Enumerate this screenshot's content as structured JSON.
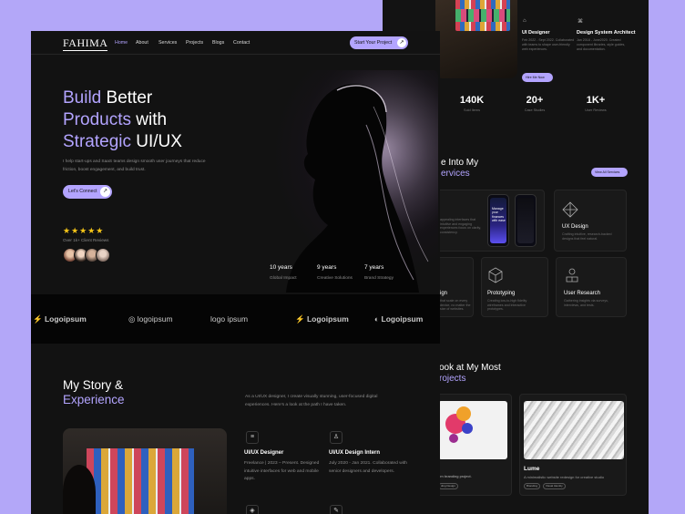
{
  "back": {
    "roles": [
      {
        "icon": "⌂",
        "title": "UI Designer",
        "desc": "Feb 2022 - Sept 2022. Collaborated with teams to shape user-friendly web experiences."
      },
      {
        "icon": "⌘",
        "title": "Design System Architect",
        "desc": "Jan 2018 - June2020. Created component libraries, style guides, and documentation."
      }
    ],
    "hire_button": "Hire Me Now",
    "stats": [
      {
        "value": "140K",
        "label": "Sold Items"
      },
      {
        "value": "20+",
        "label": "Case Studies"
      },
      {
        "value": "1K+",
        "label": "User Reviews"
      }
    ],
    "services_title_a": "e Into My",
    "services_title_b": "ervices",
    "view_services": "View All Services",
    "service_app_desc": "appealing interfaces that intuitive and engaging experiences focus on clarity, consistency.",
    "phone_text": "Manage your finances with ease",
    "services": [
      {
        "title": "UX Design",
        "desc": "Crafting intuitive, research-backed designs that feel natural."
      },
      {
        "title": "ign",
        "desc": "that scale on every device, no matter the size of websites."
      },
      {
        "title": "Prototyping",
        "desc": "Creating low-to-high fidelity wireframes and interactive prototypes."
      },
      {
        "title": "User Research",
        "desc": "Gathering insights via surveys, interviews, and tests."
      }
    ],
    "projects_title_a": "ook at My Most",
    "projects_title_b": "rojects",
    "project_left_desc": "orn branding project.",
    "project_left_tag": "ding Design",
    "project_right": {
      "title": "Lume",
      "desc": "A minimalistic website redesign for creative studio",
      "tags": [
        "Branding",
        "Visual Identity"
      ]
    }
  },
  "nav": {
    "logo": "FAHIMA",
    "links": [
      "Home",
      "About",
      "Services",
      "Projects",
      "Blogs",
      "Contact"
    ],
    "cta": "Start Your Project"
  },
  "hero": {
    "title_parts": [
      {
        "text": "Build",
        "accent": true
      },
      {
        "text": " Better ",
        "accent": false
      },
      {
        "text": "Products",
        "accent": true
      },
      {
        "text": " with ",
        "accent": false
      },
      {
        "text": "Strategic",
        "accent": true
      },
      {
        "text": " UI/UX",
        "accent": false
      }
    ],
    "subtitle": "I help start-ups and SaaS teams design smooth user journeys that reduce friction, boost engagement, and build trust.",
    "cta": "Let's Connect",
    "stars": "★★★★★",
    "reviews": "Over 1k+ Client Reviews",
    "stats": [
      {
        "value": "10 years",
        "label": "Global Impact"
      },
      {
        "value": "9 years",
        "label": "Creative Solutions"
      },
      {
        "value": "7 years",
        "label": "Brand Strategy"
      }
    ]
  },
  "clients": [
    "Logoipsum",
    "logoipsum",
    "logo ipsum",
    "Logoipsum",
    "Logoipsum"
  ],
  "story": {
    "title_a": "My Story &",
    "title_b": "Experience",
    "body": "As a UI/UX designer, I create visually stunning, user-focused digital experiences. Here's a look at the path I have taken.",
    "timeline": [
      {
        "title": "UI/UX Designer",
        "desc": "Freelance | 2023 – Present. Designed intuitive interfaces for web and mobile apps."
      },
      {
        "title": "UI/UX Design Intern",
        "desc": "July 2020 - Jan 2021. Collaborated with senior designers and developers."
      }
    ]
  },
  "colors": {
    "accent": "#b3a4ff",
    "bg": "#121212",
    "frame": "#b3a7f8"
  }
}
